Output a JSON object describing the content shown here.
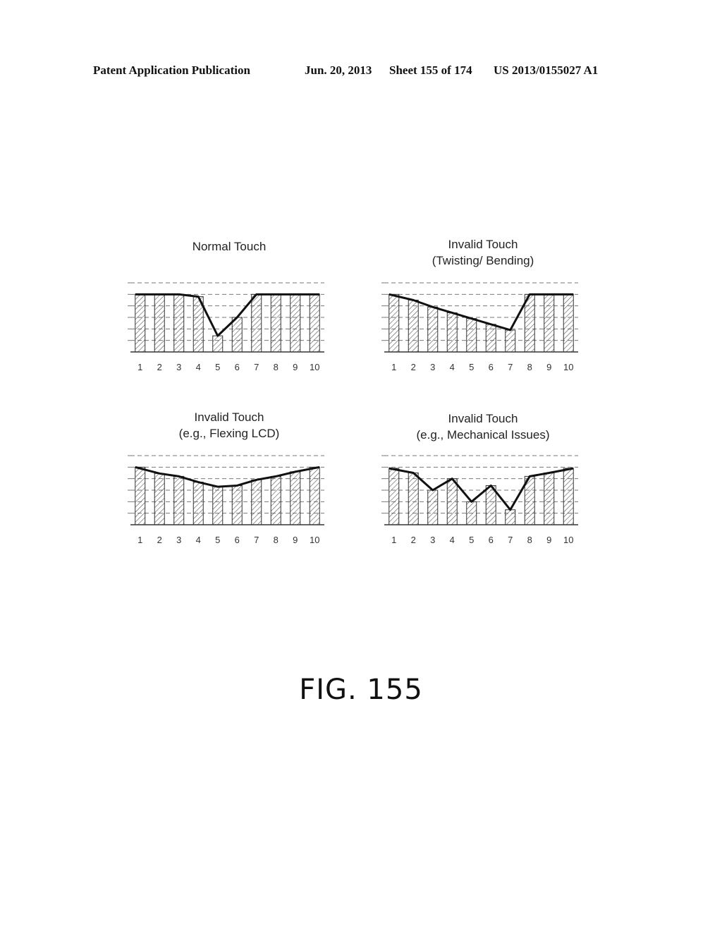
{
  "header": {
    "publication": "Patent Application Publication",
    "date": "Jun. 20, 2013",
    "sheet": "Sheet 155 of 174",
    "patent_number": "US 2013/0155027 A1"
  },
  "figure_label": "FIG. 155",
  "chart_data": [
    {
      "type": "bar",
      "title": [
        "Normal Touch"
      ],
      "categories": [
        "1",
        "2",
        "3",
        "4",
        "5",
        "6",
        "7",
        "8",
        "9",
        "10"
      ],
      "values": [
        5,
        5,
        5,
        4.8,
        1.4,
        3.0,
        5,
        5,
        5,
        5
      ],
      "overlay_line": true,
      "xlabel": "",
      "ylabel": "",
      "ylim": [
        0,
        6
      ],
      "grid": true,
      "legend": "none"
    },
    {
      "type": "bar",
      "title": [
        "Invalid Touch",
        "(Twisting/ Bending)"
      ],
      "categories": [
        "1",
        "2",
        "3",
        "4",
        "5",
        "6",
        "7",
        "8",
        "9",
        "10"
      ],
      "values": [
        5,
        4.5,
        3.9,
        3.4,
        2.9,
        2.4,
        1.9,
        5,
        5,
        5
      ],
      "overlay_line": true,
      "xlabel": "",
      "ylabel": "",
      "ylim": [
        0,
        6
      ],
      "grid": true,
      "legend": "none"
    },
    {
      "type": "bar",
      "title": [
        "Invalid Touch",
        "(e.g., Flexing LCD)"
      ],
      "categories": [
        "1",
        "2",
        "3",
        "4",
        "5",
        "6",
        "7",
        "8",
        "9",
        "10"
      ],
      "values": [
        5,
        4.45,
        4.2,
        3.7,
        3.3,
        3.4,
        3.9,
        4.2,
        4.6,
        5
      ],
      "overlay_line": true,
      "xlabel": "",
      "ylabel": "",
      "ylim": [
        0,
        6
      ],
      "grid": true,
      "legend": "none"
    },
    {
      "type": "bar",
      "title": [
        "Invalid Touch",
        "(e.g., Mechanical Issues)"
      ],
      "categories": [
        "1",
        "2",
        "3",
        "4",
        "5",
        "6",
        "7",
        "8",
        "9",
        "10"
      ],
      "values": [
        4.9,
        4.5,
        3.0,
        4.0,
        2.0,
        3.4,
        1.3,
        4.2,
        4.5,
        4.9
      ],
      "overlay_line": true,
      "xlabel": "",
      "ylabel": "",
      "ylim": [
        0,
        6
      ],
      "grid": true,
      "legend": "none"
    }
  ]
}
